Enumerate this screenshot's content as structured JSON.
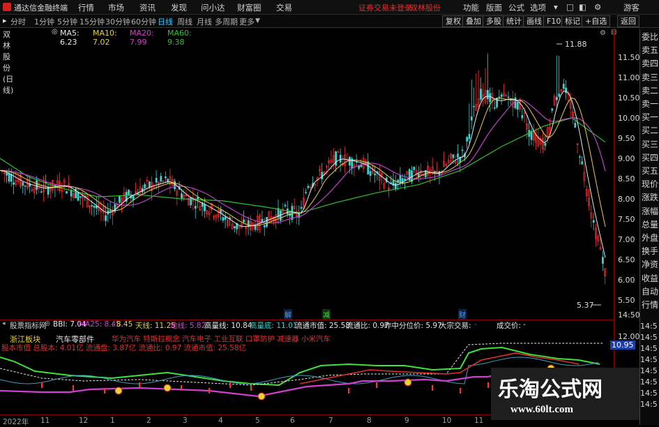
{
  "title_bar": {
    "app_name": "通达信金融终端",
    "menu": [
      "行情",
      "市场",
      "资讯",
      "发现",
      "问小达",
      "财富圈",
      "交易"
    ],
    "notice": "证券交易未登录",
    "stock_name": "双林股份",
    "right_menu": [
      "功能",
      "版面",
      "公式",
      "选项"
    ],
    "guest": "游客"
  },
  "toolbar": {
    "periods": [
      "分时",
      "1分钟",
      "5分钟",
      "15分钟",
      "30分钟",
      "60分钟",
      "日线",
      "周线",
      "月线",
      "多周期",
      "更多"
    ],
    "active_period": "日线",
    "right_buttons": [
      "复权",
      "叠加",
      "多股",
      "统计",
      "画线",
      "F10",
      "标记",
      "+自选",
      "返回"
    ]
  },
  "ma_row": {
    "stock": "双林股份(日线)",
    "ma5": "MA5: 6.23",
    "ma10": "MA10: 7.02",
    "ma20": "MA20: 7.99",
    "ma60": "MA60: 9.38",
    "colors": {
      "ma5": "#e8e8e8",
      "ma10": "#e8d040",
      "ma20": "#d040d0",
      "ma60": "#30c030"
    }
  },
  "price_axis": [
    "11.50",
    "11.00",
    "10.50",
    "10.00",
    "9.50",
    "9.00",
    "8.50",
    "8.00",
    "7.50",
    "7.00",
    "6.50",
    "6.00",
    "5.50",
    "14:50"
  ],
  "annotations": {
    "high": "11.88",
    "low": "5.37"
  },
  "event_markers": [
    "解",
    "减",
    "财"
  ],
  "right_panel": [
    "委比",
    "卖五",
    "卖四",
    "卖三",
    "卖二",
    "卖一",
    "买一",
    "买二",
    "买三",
    "买四",
    "买五",
    "现价",
    "涨跌",
    "涨幅",
    "总量",
    "外盘",
    "换手",
    "净资",
    "收益",
    "自动",
    "行情"
  ],
  "right_times": [
    "14:5",
    "14:5",
    "14:5",
    "14:5",
    "14:5",
    "14:5",
    "14:5",
    "14:5"
  ],
  "indicator": {
    "name": "股票指标网",
    "bbi": "BBI: 7.04",
    "ma25": "MA25: 8.45",
    "v845": ": 8.45",
    "tianxian": "天线: 11.25",
    "dixian": "地线: 5.82",
    "gaoliang": "高量线: 10.84",
    "gaoliangdi": "高量底: 11.01",
    "liutong_sz": "流通市值: 25.58",
    "liutong_bi": "流通比: 0.97",
    "zuori": "昨中分位价: 5.97",
    "dazong": "大宗交易:",
    "dazong_val": "-",
    "chengjiao": "成交价:",
    "chengjiao_val": "-",
    "axis_top": "12.00",
    "axis_val": "10.95",
    "row1": [
      "浙江板块",
      "汽车零部件",
      "华为汽车 特斯拉概念 汽车电子 工业互联 口罩防护 减速器 小米汽车"
    ],
    "row2": "股本市值 总股本: 4.01亿  流通盘: 3.87亿  流通比: 0.97  流通市值: 25.58亿"
  },
  "date_axis": [
    "2022年",
    "11",
    "12",
    "1",
    "2",
    "3",
    "4",
    "5",
    "6",
    "7",
    "8",
    "9",
    "10",
    "11"
  ],
  "watermark": {
    "title": "乐淘公式网",
    "url": "www.60lt.com"
  }
}
